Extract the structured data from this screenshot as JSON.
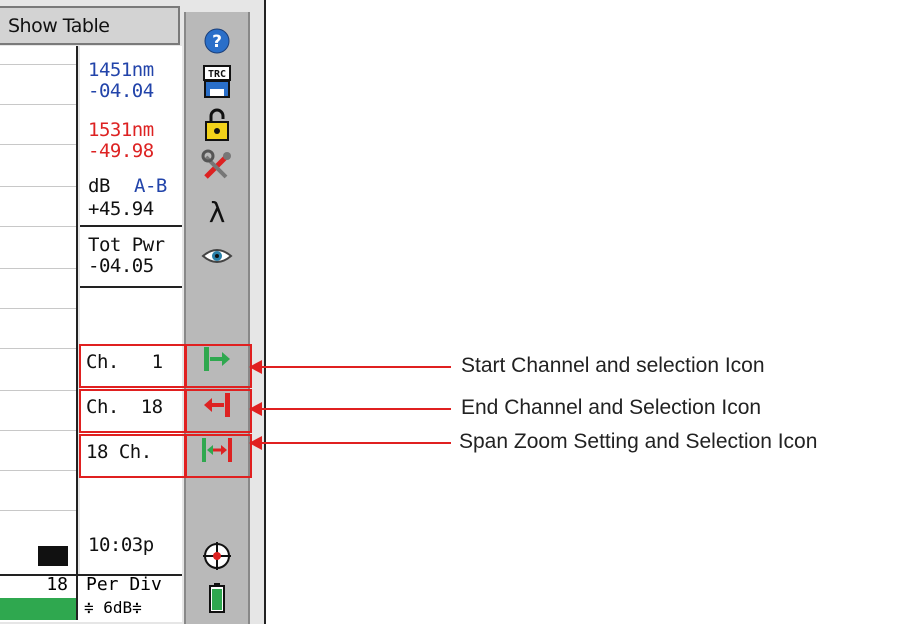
{
  "header": {
    "show_table_label": "Show Table"
  },
  "readout": {
    "marker_a": {
      "wavelength": "1451nm",
      "power": "-04.04"
    },
    "marker_b": {
      "wavelength": "1531nm",
      "power": "-49.98"
    },
    "difference": {
      "unit": "dB",
      "label": "A-B",
      "value": "+45.94"
    },
    "total_power": {
      "label": "Tot Pwr",
      "value": "-04.05"
    },
    "start_channel": "Ch.   1",
    "end_channel": "Ch.  18",
    "span_zoom": "18 Ch.",
    "clock": "10:03p"
  },
  "scale": {
    "per_div_value": "18",
    "per_div_label": "Per Div",
    "per_div_setting": "≑ 6dB≑"
  },
  "toolbar": {
    "icons": [
      "help-icon",
      "trace-save-icon",
      "lock-icon",
      "tools-icon",
      "lambda-icon",
      "eye-icon",
      "start-channel-icon",
      "end-channel-icon",
      "span-zoom-icon",
      "target-icon",
      "battery-icon"
    ],
    "trace_label": "TRC",
    "lambda_glyph": "λ"
  },
  "callouts": {
    "start": "Start Channel and  selection Icon",
    "end": "End Channel and Selection Icon",
    "span": "Span Zoom Setting and Selection Icon"
  },
  "colors": {
    "marker_a": "#2244aa",
    "marker_b": "#dd2222",
    "annotation": "#e02020",
    "scale_bar": "#2fa84f",
    "toolbar": "#b9b9b9"
  }
}
